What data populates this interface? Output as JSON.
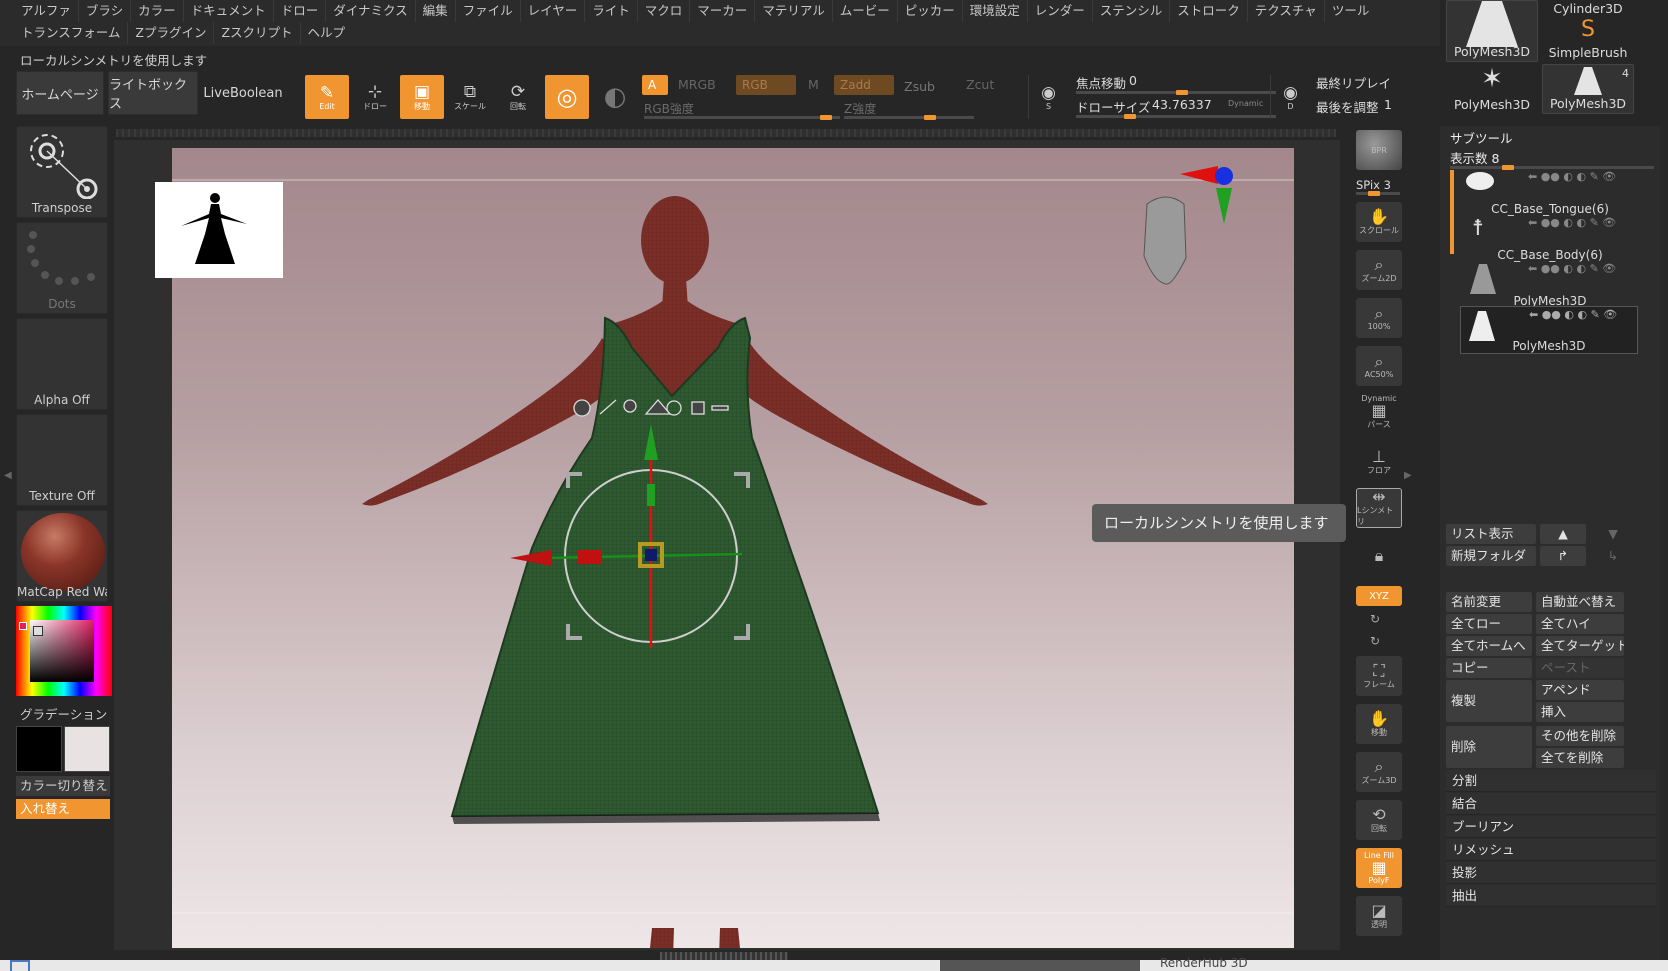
{
  "menu_row1": [
    "アルファ",
    "ブラシ",
    "カラー",
    "ドキュメント",
    "ドロー",
    "ダイナミクス",
    "編集",
    "ファイル",
    "レイヤー",
    "ライト",
    "マクロ",
    "マーカー",
    "マテリアル",
    "ムービー",
    "ピッカー",
    "環境設定",
    "レンダー",
    "ステンシル",
    "ストローク",
    "テクスチャ",
    "ツール"
  ],
  "menu_row2": [
    "トランスフォーム",
    "Zプラグイン",
    "Zスクリプト",
    "ヘルプ"
  ],
  "status_tip": "ローカルシンメトリを使用します",
  "toolbar": {
    "home": "ホームページ",
    "lightbox": "ライトボックス",
    "liveboolean": "LiveBoolean",
    "edit": "Edit",
    "draw": "ドロー",
    "move": "移動",
    "scale": "スケール",
    "rotate": "回転",
    "a_chip": "A",
    "mrgb": "MRGB",
    "rgb": "RGB",
    "m": "M",
    "rgb_intensity": "RGB強度",
    "zadd": "Zadd",
    "zsub": "Zsub",
    "zcut": "Zcut",
    "z_intensity": "Z強度",
    "focal_shift_label": "焦点移動",
    "focal_shift_value": "0",
    "draw_size_label": "ドローサイズ",
    "draw_size_value": "43.76337",
    "dynamic": "Dynamic",
    "last_replay": "最終リプレイ",
    "adjust_last_label": "最後を調整",
    "adjust_last_value": "1",
    "s_label": "S",
    "d_label": "D"
  },
  "left_panel": {
    "transpose": "Transpose",
    "dots": "Dots",
    "alpha": "Alpha Off",
    "texture": "Texture Off",
    "material": "MatCap Red Wax",
    "gradation": "グラデーション",
    "color_switch": "カラー切り替え",
    "swap": "入れ替え"
  },
  "right_tools": {
    "bpr": "BPR",
    "spix": "SPix 3",
    "scroll": "スクロール",
    "zoom2d": "ズーム2D",
    "hundred": "100%",
    "ac50": "AC50%",
    "dynamic": "Dynamic",
    "persp": "パース",
    "floor": "フロア",
    "localsym": "Lシンメトリ",
    "xyz": "XYZ",
    "frame": "フレーム",
    "move": "移動",
    "zoom3d": "ズーム3D",
    "rotate": "回転",
    "linefill": "Line Fill",
    "polyf": "PolyF",
    "transp": "透明"
  },
  "tooltip": "ローカルシンメトリを使用します",
  "tool_tray": [
    {
      "name": "PolyMesh3D"
    },
    {
      "name": "Cylinder3D"
    },
    {
      "name": "SimpleBrush"
    },
    {
      "name": "PolyMesh3D"
    },
    {
      "name": "PolyMesh3D",
      "badge": "4"
    }
  ],
  "subtool": {
    "title": "サブツール",
    "visible_count": "表示数 8",
    "items": [
      {
        "name": "CC_Base_Tongue(6)"
      },
      {
        "name": "CC_Base_Body(6)"
      },
      {
        "name": "PolyMesh3D"
      },
      {
        "name": "PolyMesh3D"
      }
    ],
    "list_view": "リスト表示",
    "new_folder": "新規フォルダ",
    "rename": "名前変更",
    "auto_sort": "自動並べ替え",
    "all_low": "全てロー",
    "all_high": "全てハイ",
    "all_home": "全てホームへ",
    "all_target": "全てターゲットへ",
    "copy": "コピー",
    "paste": "ペースト",
    "duplicate": "複製",
    "append": "アペンド",
    "insert": "挿入",
    "delete": "削除",
    "delete_others": "その他を削除",
    "delete_all": "全てを削除",
    "sections": [
      "分割",
      "結合",
      "ブーリアン",
      "リメッシュ",
      "投影",
      "抽出"
    ]
  },
  "taskbar_text": "RenderHub 3D",
  "colors": {
    "accent": "#f0952f",
    "dress": "#2e5a30",
    "skin": "#7a2e27"
  }
}
